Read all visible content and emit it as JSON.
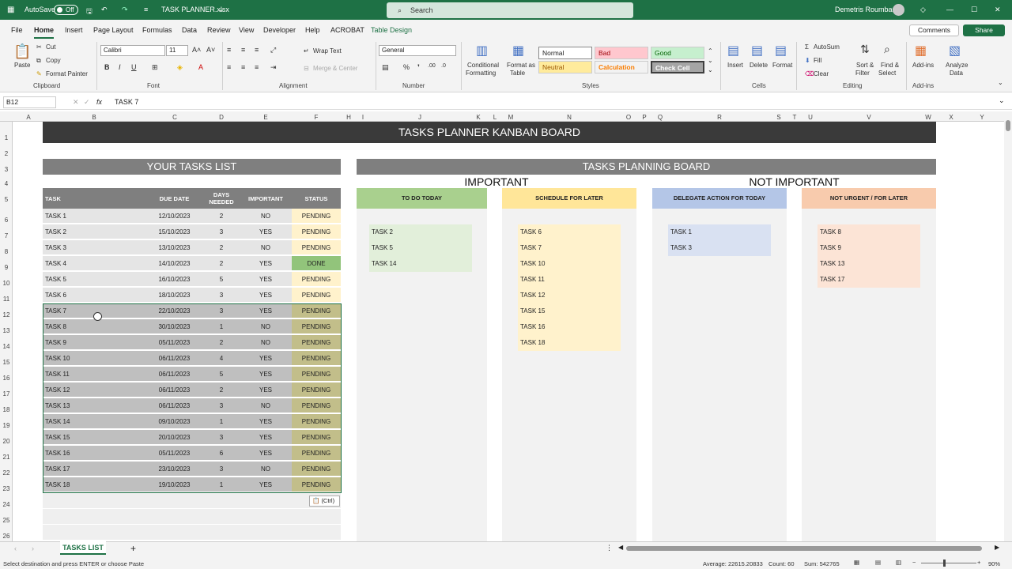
{
  "titlebar": {
    "autosave": "AutoSave",
    "toggle": "Off",
    "filename": "TASK PLANNER.xlsx",
    "search": "Search",
    "user": "Demetris Roumbas"
  },
  "menu": {
    "tabs": [
      "File",
      "Home",
      "Insert",
      "Page Layout",
      "Formulas",
      "Data",
      "Review",
      "View",
      "Developer",
      "Help",
      "ACROBAT",
      "Table Design"
    ],
    "comments": "Comments",
    "share": "Share"
  },
  "ribbon": {
    "paste": "Paste",
    "cut": "Cut",
    "copy": "Copy",
    "format_painter": "Format Painter",
    "clipboard": "Clipboard",
    "font_name": "Calibri",
    "font_size": "11",
    "font_group": "Font",
    "wrap_text": "Wrap Text",
    "merge": "Merge & Center",
    "alignment": "Alignment",
    "number_format": "General",
    "number": "Number",
    "conditional": "Conditional",
    "formatting": "Formatting",
    "format_as": "Format as",
    "table": "Table",
    "styles": [
      "Normal",
      "Bad",
      "Good",
      "Neutral",
      "Calculation",
      "Check Cell"
    ],
    "styles_group": "Styles",
    "insert": "Insert",
    "delete": "Delete",
    "format": "Format",
    "cells": "Cells",
    "autosum": "AutoSum",
    "fill": "Fill",
    "clear": "Clear",
    "sort": "Sort &",
    "filter": "Filter",
    "find": "Find &",
    "select": "Select",
    "editing": "Editing",
    "addins": "Add-ins",
    "analyze": "Analyze",
    "data": "Data",
    "addins_group": "Add-ins"
  },
  "formula": {
    "namebox": "B12",
    "fx": "fx",
    "content": "TASK 7"
  },
  "columns": [
    "A",
    "B",
    "C",
    "D",
    "E",
    "F",
    "H",
    "I",
    "J",
    "K",
    "L",
    "M",
    "N",
    "O",
    "P",
    "Q",
    "R",
    "S",
    "T",
    "U",
    "V",
    "W",
    "X",
    "Y"
  ],
  "rows": [
    "1",
    "2",
    "3",
    "4",
    "5",
    "6",
    "7",
    "8",
    "9",
    "10",
    "11",
    "12",
    "13",
    "14",
    "15",
    "16",
    "17",
    "18",
    "19",
    "20",
    "21",
    "22",
    "23",
    "24",
    "25",
    "26"
  ],
  "banner": "TASKS PLANNER KANBAN BOARD",
  "tasks_list": {
    "title": "YOUR TASKS LIST",
    "headers": {
      "task": "TASK",
      "due": "DUE DATE",
      "days1": "DAYS",
      "days2": "NEEDED",
      "important": "IMPORTANT",
      "status": "STATUS"
    },
    "rows": [
      {
        "task": "TASK 1",
        "due": "12/10/2023",
        "days": "2",
        "important": "NO",
        "status": "PENDING"
      },
      {
        "task": "TASK 2",
        "due": "15/10/2023",
        "days": "3",
        "important": "YES",
        "status": "PENDING"
      },
      {
        "task": "TASK 3",
        "due": "13/10/2023",
        "days": "2",
        "important": "NO",
        "status": "PENDING"
      },
      {
        "task": "TASK 4",
        "due": "14/10/2023",
        "days": "2",
        "important": "YES",
        "status": "DONE"
      },
      {
        "task": "TASK 5",
        "due": "16/10/2023",
        "days": "5",
        "important": "YES",
        "status": "PENDING"
      },
      {
        "task": "TASK 6",
        "due": "18/10/2023",
        "days": "3",
        "important": "YES",
        "status": "PENDING"
      },
      {
        "task": "TASK 7",
        "due": "22/10/2023",
        "days": "3",
        "important": "YES",
        "status": "PENDING"
      },
      {
        "task": "TASK 8",
        "due": "30/10/2023",
        "days": "1",
        "important": "NO",
        "status": "PENDING"
      },
      {
        "task": "TASK 9",
        "due": "05/11/2023",
        "days": "2",
        "important": "NO",
        "status": "PENDING"
      },
      {
        "task": "TASK 10",
        "due": "06/11/2023",
        "days": "4",
        "important": "YES",
        "status": "PENDING"
      },
      {
        "task": "TASK 11",
        "due": "06/11/2023",
        "days": "5",
        "important": "YES",
        "status": "PENDING"
      },
      {
        "task": "TASK 12",
        "due": "06/11/2023",
        "days": "2",
        "important": "YES",
        "status": "PENDING"
      },
      {
        "task": "TASK 13",
        "due": "06/11/2023",
        "days": "3",
        "important": "NO",
        "status": "PENDING"
      },
      {
        "task": "TASK 14",
        "due": "09/10/2023",
        "days": "1",
        "important": "YES",
        "status": "PENDING"
      },
      {
        "task": "TASK 15",
        "due": "20/10/2023",
        "days": "3",
        "important": "YES",
        "status": "PENDING"
      },
      {
        "task": "TASK 16",
        "due": "05/11/2023",
        "days": "6",
        "important": "YES",
        "status": "PENDING"
      },
      {
        "task": "TASK 17",
        "due": "23/10/2023",
        "days": "3",
        "important": "NO",
        "status": "PENDING"
      },
      {
        "task": "TASK 18",
        "due": "19/10/2023",
        "days": "1",
        "important": "YES",
        "status": "PENDING"
      }
    ]
  },
  "board": {
    "title": "TASKS PLANNING BOARD",
    "important": "IMPORTANT",
    "not_important": "NOT IMPORTANT",
    "columns": [
      {
        "title": "TO DO TODAY",
        "head_color": "#a9d08e",
        "card_color": "#e2efda",
        "tasks": [
          "TASK 2",
          "TASK 5",
          "TASK 14"
        ]
      },
      {
        "title": "SCHEDULE FOR LATER",
        "head_color": "#ffe699",
        "card_color": "#fff2cc",
        "tasks": [
          "TASK 6",
          "TASK 7",
          "TASK 10",
          "TASK 11",
          "TASK 12",
          "TASK 15",
          "TASK 16",
          "TASK 18"
        ]
      },
      {
        "title": "DELEGATE ACTION FOR TODAY",
        "head_color": "#b4c6e7",
        "card_color": "#d9e1f2",
        "tasks": [
          "TASK 1",
          "TASK 3"
        ]
      },
      {
        "title": "NOT URGENT / FOR LATER",
        "head_color": "#f8cbad",
        "card_color": "#fce4d6",
        "tasks": [
          "TASK 8",
          "TASK 9",
          "TASK 13",
          "TASK 17"
        ]
      }
    ]
  },
  "paste_options": "(Ctrl)",
  "sheet_tab": "TASKS LIST",
  "status": {
    "message": "Select destination and press ENTER or choose Paste",
    "average": "Average: 22615.20833",
    "count": "Count: 60",
    "sum": "Sum: 542765",
    "zoom": "90%"
  },
  "colors": {
    "excel_green": "#1e7145",
    "header_gray": "#7f7f7f",
    "banner_dark": "#3a3a3a",
    "done_green": "#92c47b",
    "pending_yellow": "#fff2cc"
  }
}
